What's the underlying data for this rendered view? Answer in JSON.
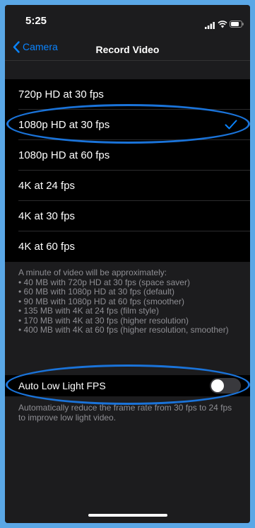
{
  "status_bar": {
    "time": "5:25",
    "icons": [
      "cellular-signal-icon",
      "wifi-icon",
      "battery-icon"
    ]
  },
  "nav": {
    "back_label": "Camera",
    "title": "Record Video"
  },
  "options": [
    {
      "label": "720p HD at 30 fps",
      "selected": false
    },
    {
      "label": "1080p HD at 30 fps",
      "selected": true
    },
    {
      "label": "1080p HD at 60 fps",
      "selected": false
    },
    {
      "label": "4K at 24 fps",
      "selected": false
    },
    {
      "label": "4K at 30 fps",
      "selected": false
    },
    {
      "label": "4K at 60 fps",
      "selected": false
    }
  ],
  "footer": {
    "lines": [
      "A minute of video will be approximately:",
      "• 40 MB with 720p HD at 30 fps (space saver)",
      "• 60 MB with 1080p HD at 30 fps (default)",
      "• 90 MB with 1080p HD at 60 fps (smoother)",
      "• 135 MB with 4K at 24 fps (film style)",
      "• 170 MB with 4K at 30 fps (higher resolution)",
      "• 400 MB with 4K at 60 fps (higher resolution, smoother)"
    ]
  },
  "auto_low_light": {
    "label": "Auto Low Light FPS",
    "enabled": false,
    "description": "Automatically reduce the frame rate from 30 fps to 24 fps to improve low light video."
  },
  "colors": {
    "accent": "#0a84ff",
    "annotation": "#1a73d9",
    "screenshot_border": "#5aa7e6"
  }
}
